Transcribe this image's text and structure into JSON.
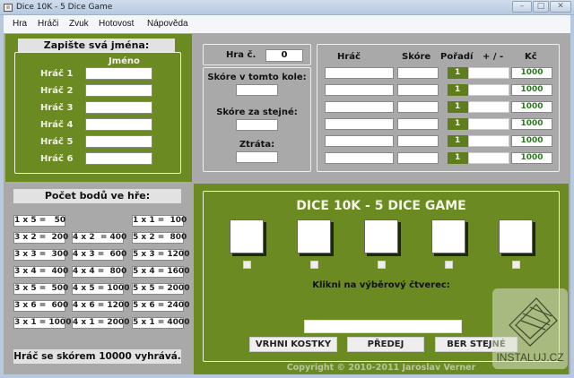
{
  "window": {
    "title": "Dice 10K - 5 Dice Game"
  },
  "menu": [
    "Hra",
    "Hráči",
    "Zvuk",
    "Hotovost",
    "Nápověda"
  ],
  "names_panel": {
    "header": "Zapište svá jména:",
    "column": "Jméno",
    "players": [
      "Hráč 1",
      "Hráč 2",
      "Hráč 3",
      "Hráč 4",
      "Hráč 5",
      "Hráč 6"
    ]
  },
  "points_panel": {
    "header": "Počet bodů ve hře:",
    "col1": [
      "1 x 5 =   50",
      "3 x 2 =  200",
      "3 x 3 =  300",
      "3 x 4 =  400",
      "3 x 5 =  500",
      "3 x 6 =  600",
      "3 x 1 = 1000"
    ],
    "col2": [
      "4 x 2  = 400",
      "4 x 3 =  600",
      "4 x 4 =  800",
      "4 x 5 = 1000",
      "4 x 6 = 1200",
      "4 x 1 = 2000"
    ],
    "col3": [
      "1 x 1 =  100",
      "5 x 2 =  800",
      "5 x 3 = 1200",
      "5 x 4 = 1600",
      "5 x 5 = 2000",
      "5 x 6 = 2400",
      "5 x 1 = 4000"
    ],
    "footer": "Hráč se skórem 10000 vyhrává."
  },
  "game_info": {
    "game_no_label": "Hra č.",
    "game_no": "0",
    "round_score_label": "Skóre v tomto kole:",
    "same_score_label": "Skóre za stejné:",
    "loss_label": "Ztráta:"
  },
  "score_table": {
    "headers": [
      "Hráč",
      "Skóre",
      "Pořadí",
      "+ / -",
      "Kč"
    ],
    "rows": [
      {
        "rank": "1",
        "kc": "1000"
      },
      {
        "rank": "1",
        "kc": "1000"
      },
      {
        "rank": "1",
        "kc": "1000"
      },
      {
        "rank": "1",
        "kc": "1000"
      },
      {
        "rank": "1",
        "kc": "1000"
      },
      {
        "rank": "1",
        "kc": "1000"
      }
    ]
  },
  "game": {
    "title": "DICE 10K - 5 DICE GAME",
    "instruction": "Klikni na výběrový čtverec:",
    "buttons": {
      "roll": "VRHNI KOSTKY",
      "pass": "PŘEDEJ",
      "take": "BER STEJNÉ"
    },
    "copyright": "Copyright © 2010-2011 Jaroslav Verner"
  },
  "watermark": "INSTALUJ.CZ",
  "colors": {
    "green": "#6b8a22",
    "gray": "#a9a9a9",
    "money": "#2a7a1c"
  }
}
